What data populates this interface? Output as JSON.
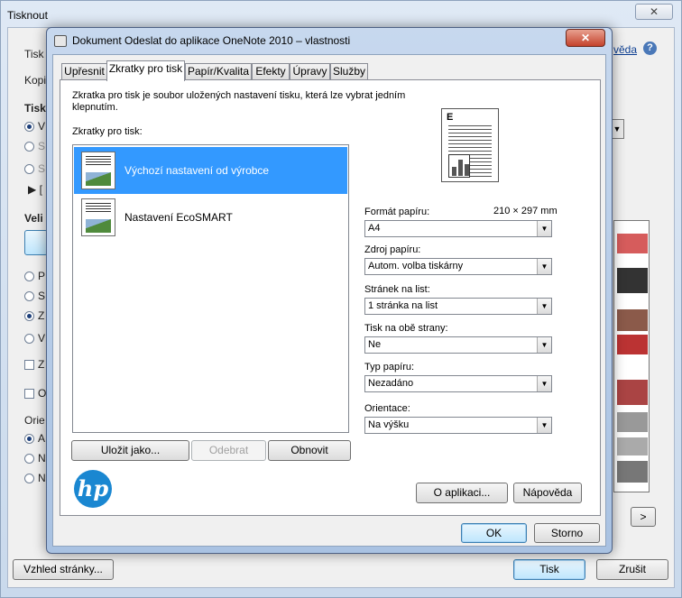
{
  "bg_window": {
    "title": "Tisknout",
    "close": "✕",
    "help_link": "vědа",
    "help_icon": "?",
    "left_labels": [
      "Tisk",
      "Kopi",
      "Tisk",
      "V",
      "S",
      "S",
      "[",
      "Veli",
      "P",
      "S",
      "Z",
      "V",
      "Z",
      "O",
      "Orie",
      "A",
      "N",
      "N"
    ],
    "page_setup_button": "Vzhled stránky...",
    "print_button": "Tisk",
    "cancel_button": "Zrušit",
    "next_button": ">"
  },
  "dialog": {
    "title": "Dokument Odeslat do aplikace OneNote 2010 – vlastnosti",
    "close": "✕",
    "tabs": [
      "Upřesnit",
      "Zkratky pro tisk",
      "Papír/Kvalita",
      "Efekty",
      "Úpravy",
      "Služby"
    ],
    "description": "Zkratka pro tisk je soubor uložených nastavení tisku, která lze vybrat jedním klepnutím.",
    "shortcuts_label": "Zkratky pro tisk:",
    "shortcuts": [
      "Výchozí nastavení od výrobce",
      "Nastavení EcoSMART"
    ],
    "save_as_button": "Uložit jako...",
    "delete_button": "Odebrat",
    "restore_button": "Obnovit",
    "paper_format": {
      "label": "Formát papíru:",
      "size": "210 × 297 mm",
      "value": "A4"
    },
    "paper_source": {
      "label": "Zdroj papíru:",
      "value": "Autom. volba tiskárny"
    },
    "pages_per_sheet": {
      "label": "Stránek na list:",
      "value": "1 stránka na list"
    },
    "duplex": {
      "label": "Tisk na obě strany:",
      "value": "Ne"
    },
    "paper_type": {
      "label": "Typ papíru:",
      "value": "Nezadáno"
    },
    "orientation": {
      "label": "Orientace:",
      "value": "Na výšku"
    },
    "about_button": "O aplikaci...",
    "help_button": "Nápověda",
    "ok_button": "OK",
    "cancel_button": "Storno",
    "logo_text": "hp"
  }
}
